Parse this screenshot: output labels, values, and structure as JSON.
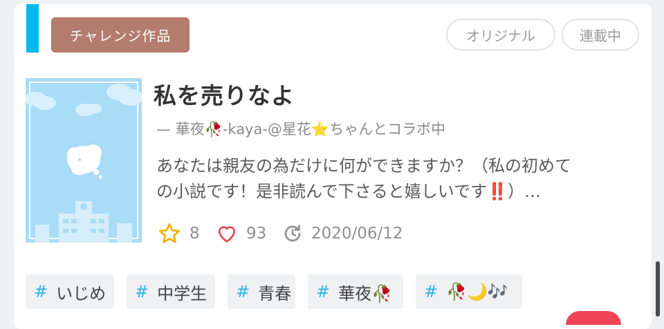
{
  "card": {
    "badge": "チャレンジ作品",
    "pills": [
      "オリジナル",
      "連載中"
    ],
    "title": "私を売りなよ",
    "author": "— 華夜🥀-kaya-@星花⭐ちゃんとコラボ中",
    "summary_line1": "あなたは親友の為だけに何ができますか？（私の初めて",
    "summary_line2_text": "の小説です！是非読んで下さると嬉しいです",
    "summary_line2_marks": "‼️",
    "summary_line2_end": "）…",
    "stats": {
      "stars": "8",
      "likes": "93",
      "updated": "2020/06/12"
    },
    "tags": [
      {
        "hash": "#",
        "label": "いじめ"
      },
      {
        "hash": "#",
        "label": "中学生"
      },
      {
        "hash": "#",
        "label": "青春"
      },
      {
        "hash": "#",
        "label": "華夜🥀"
      },
      {
        "hash": "#",
        "label": "🥀🌙🎶"
      }
    ]
  },
  "colors": {
    "accent": "#00b7ee",
    "badge": "#b37c6c",
    "hashtag": "#2fb3ea",
    "star": "#f3b300",
    "heart": "#e5434f",
    "fab": "#f04458"
  },
  "icons": {
    "cover": "cloud-school-cover-image",
    "star": "star-outline-icon",
    "heart": "heart-outline-icon",
    "update": "refresh-clock-icon"
  }
}
